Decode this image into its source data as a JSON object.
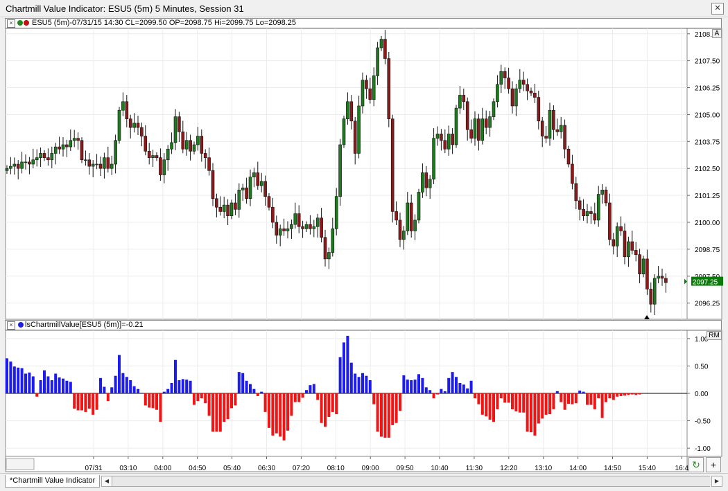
{
  "window": {
    "title": "Chartmill Value Indicator: ESU5 (5m) 5 Minutes, Session 31",
    "close_symbol": "✕"
  },
  "price_panel": {
    "header": "ESU5 (5m)-07/31/15 14:30 CL=2099.50 OP=2098.75 Hi=2099.75 Lo=2098.25",
    "badge": "A",
    "last_price": "2097.25",
    "colors": {
      "up": "#1f7a1f",
      "down": "#8b1a1a",
      "last_badge": "#0a7a0a"
    }
  },
  "indicator_panel": {
    "header": "lsChartmillValue[ESU5 (5m)]=-0.21",
    "badge": "RM",
    "colors": {
      "positive": "#1c1cf0",
      "negative": "#f01414"
    }
  },
  "bottom": {
    "tab_label": "*Chartmill Value Indicator",
    "refresh_icon": "↻",
    "plus_icon": "+"
  },
  "chart_data": [
    {
      "type": "candlestick",
      "title": "ESU5 (5m)",
      "ylim": [
        2095.5,
        2109.0
      ],
      "y_ticks": [
        "2108.75",
        "2107.50",
        "2106.25",
        "2105.00",
        "2103.75",
        "2102.50",
        "2101.25",
        "2100.00",
        "2098.75",
        "2097.50",
        "2096.25"
      ],
      "x_ticks": [
        "07/31",
        "03:10",
        "04:00",
        "04:50",
        "05:40",
        "06:30",
        "07:20",
        "08:10",
        "09:00",
        "09:50",
        "10:40",
        "11:30",
        "12:20",
        "13:10",
        "14:00",
        "14:50",
        "15:40",
        "16:4"
      ],
      "close": [
        2102.5,
        2102.6,
        2102.7,
        2102.5,
        2102.8,
        2102.8,
        2102.7,
        2102.9,
        2103.0,
        2103.2,
        2103.0,
        2102.9,
        2103.2,
        2103.5,
        2103.4,
        2103.6,
        2103.5,
        2103.8,
        2103.9,
        2103.8,
        2102.9,
        2102.9,
        2102.6,
        2102.7,
        2102.7,
        2102.5,
        2103.0,
        2102.5,
        2102.7,
        2103.8,
        2105.2,
        2105.6,
        2104.8,
        2104.4,
        2104.6,
        2104.4,
        2104.0,
        2103.3,
        2103.0,
        2103.1,
        2103.0,
        2102.2,
        2102.9,
        2103.4,
        2103.7,
        2104.9,
        2104.2,
        2103.4,
        2103.8,
        2103.3,
        2103.6,
        2104.0,
        2103.2,
        2103.0,
        2102.4,
        2101.1,
        2100.7,
        2100.5,
        2100.8,
        2100.3,
        2100.9,
        2100.6,
        2101.5,
        2101.6,
        2101.1,
        2102.1,
        2102.3,
        2101.7,
        2101.9,
        2101.2,
        2100.7,
        2100.0,
        2099.4,
        2099.7,
        2099.6,
        2099.7,
        2099.9,
        2100.4,
        2099.8,
        2099.7,
        2099.9,
        2099.7,
        2099.8,
        2100.2,
        2099.3,
        2098.3,
        2098.6,
        2099.7,
        2101.2,
        2103.6,
        2104.8,
        2105.6,
        2104.7,
        2103.2,
        2105.4,
        2106.6,
        2106.2,
        2105.7,
        2106.8,
        2108.1,
        2108.5,
        2107.6,
        2104.8,
        2100.5,
        2100.1,
        2099.2,
        2099.6,
        2100.9,
        2099.6,
        2100.1,
        2101.4,
        2102.3,
        2101.6,
        2102.0,
        2103.9,
        2104.1,
        2103.8,
        2103.4,
        2104.1,
        2103.6,
        2105.3,
        2105.9,
        2105.6,
        2104.3,
        2103.9,
        2104.8,
        2103.8,
        2104.8,
        2104.4,
        2104.9,
        2105.6,
        2106.4,
        2107.0,
        2106.7,
        2106.2,
        2105.4,
        2106.2,
        2106.6,
        2106.4,
        2106.1,
        2106.0,
        2105.8,
        2104.7,
        2104.0,
        2103.9,
        2105.2,
        2104.3,
        2104.2,
        2104.5,
        2103.4,
        2102.7,
        2101.8,
        2101.0,
        2100.6,
        2100.3,
        2100.5,
        2100.4,
        2100.1,
        2101.3,
        2101.5,
        2100.9,
        2099.2,
        2098.9,
        2099.8,
        2099.6,
        2098.4,
        2099.1,
        2098.7,
        2098.5,
        2097.6,
        2098.3,
        2096.9,
        2096.2,
        2097.4,
        2097.5,
        2097.4,
        2097.2
      ]
    },
    {
      "type": "bar",
      "title": "lsChartmillValue",
      "ylim": [
        -1.15,
        1.15
      ],
      "y_ticks": [
        "1.00",
        "0.50",
        "0.00",
        "-0.50",
        "-1.00"
      ],
      "values": [
        0.64,
        0.58,
        0.49,
        0.47,
        0.46,
        0.36,
        0.38,
        0.31,
        -0.06,
        0.24,
        0.42,
        0.31,
        0.24,
        0.36,
        0.29,
        0.27,
        0.23,
        0.21,
        -0.28,
        -0.31,
        -0.31,
        -0.34,
        -0.28,
        -0.39,
        -0.3,
        0.28,
        0.12,
        -0.14,
        0.11,
        0.32,
        0.7,
        0.37,
        0.3,
        0.24,
        0.13,
        0.08,
        0.01,
        -0.22,
        -0.26,
        -0.27,
        -0.3,
        -0.52,
        0.03,
        0.08,
        0.19,
        0.61,
        0.24,
        0.26,
        0.25,
        0.23,
        -0.21,
        -0.14,
        -0.09,
        -0.18,
        -0.41,
        -0.7,
        -0.7,
        -0.7,
        -0.52,
        -0.47,
        -0.27,
        -0.22,
        0.39,
        0.37,
        0.23,
        0.17,
        0.08,
        -0.05,
        0.03,
        -0.34,
        -0.63,
        -0.77,
        -0.73,
        -0.79,
        -0.86,
        -0.68,
        -0.41,
        -0.16,
        -0.16,
        -0.08,
        0.06,
        0.15,
        0.17,
        -0.12,
        -0.54,
        -0.61,
        -0.43,
        -0.34,
        -0.38,
        0.66,
        0.93,
        1.05,
        0.56,
        0.36,
        0.3,
        0.37,
        0.32,
        0.24,
        -0.2,
        -0.7,
        -0.79,
        -0.81,
        -0.81,
        -0.58,
        -0.54,
        -0.32,
        0.33,
        0.25,
        0.24,
        0.25,
        0.35,
        0.28,
        0.11,
        0.06,
        -0.09,
        -0.02,
        0.08,
        0.04,
        0.28,
        0.39,
        0.3,
        0.19,
        0.16,
        0.09,
        0.23,
        -0.09,
        -0.2,
        -0.39,
        -0.42,
        -0.48,
        -0.52,
        -0.29,
        -0.09,
        -0.17,
        -0.17,
        -0.29,
        -0.33,
        -0.35,
        -0.35,
        -0.7,
        -0.71,
        -0.77,
        -0.55,
        -0.46,
        -0.39,
        -0.38,
        -0.29,
        0.04,
        -0.16,
        -0.3,
        -0.19,
        -0.2,
        -0.18,
        0.05,
        0.03,
        -0.21,
        -0.21,
        -0.29,
        -0.09,
        -0.45,
        -0.16,
        -0.09,
        -0.12,
        -0.06,
        -0.05,
        -0.04,
        -0.03,
        -0.02,
        -0.03,
        -0.02
      ]
    }
  ]
}
